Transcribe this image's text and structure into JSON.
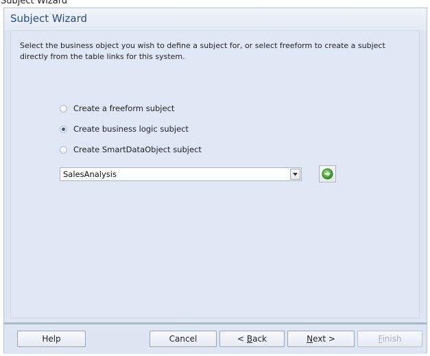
{
  "top_strip_text": "Subject Wizard",
  "window": {
    "title": "Subject Wizard"
  },
  "description": "Select the business object you wish to define a subject for, or select freeform to create a subject directly from the table links for this system.",
  "options": [
    {
      "label": "Create a freeform subject",
      "selected": false
    },
    {
      "label": "Create business logic subject",
      "selected": true
    },
    {
      "label": "Create SmartDataObject subject",
      "selected": false
    }
  ],
  "business_object": {
    "value": "SalesAnalysis"
  },
  "buttons": {
    "help": "Help",
    "cancel": "Cancel",
    "back_prefix": "< ",
    "back_mnemonic": "B",
    "back_rest": "ack",
    "next_mnemonic": "N",
    "next_rest": "ext >",
    "finish_mnemonic": "F",
    "finish_rest": "inish",
    "finish_enabled": false
  },
  "colors": {
    "title": "#1f4d8f",
    "panel": "#dfe8f4",
    "go_icon": "#3a9d2b"
  },
  "icons": {
    "dropdown": "chevron-down-icon",
    "go": "green-arrow-circle-icon"
  }
}
